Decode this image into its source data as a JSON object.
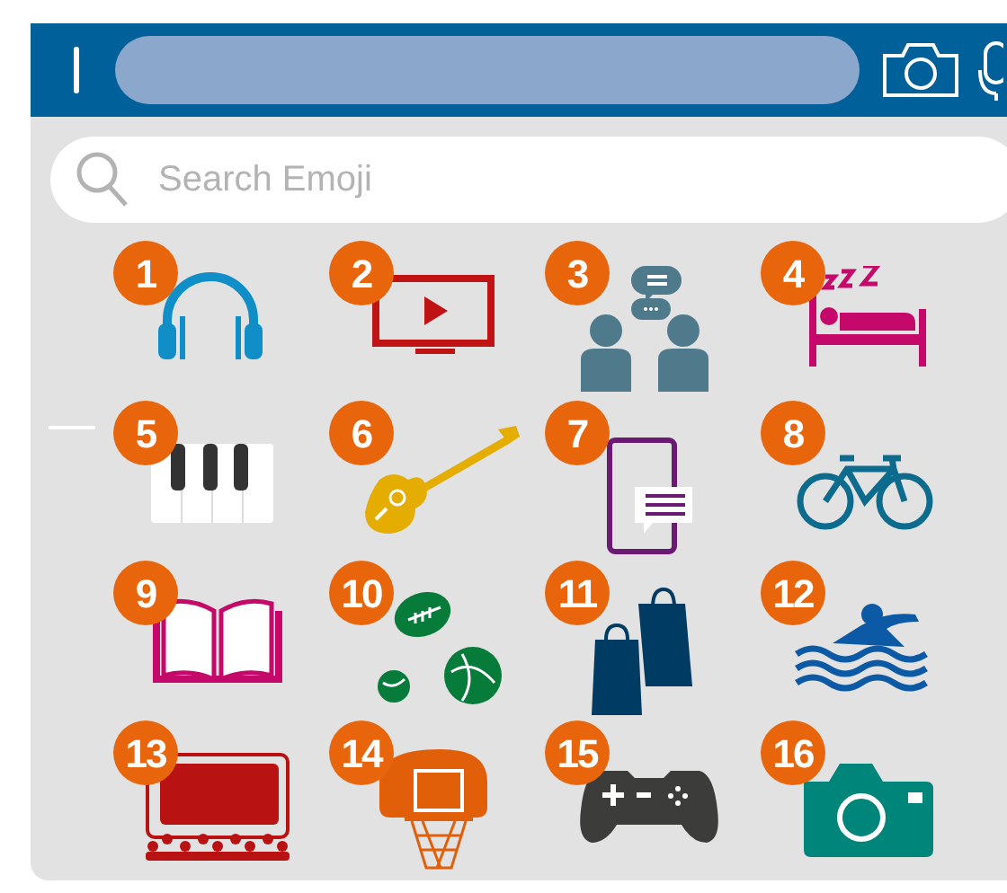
{
  "search": {
    "placeholder": "Search Emoji"
  },
  "items": [
    {
      "number": "1",
      "kind": "headphones"
    },
    {
      "number": "2",
      "kind": "tv"
    },
    {
      "number": "3",
      "kind": "chat"
    },
    {
      "number": "4",
      "kind": "sleep"
    },
    {
      "number": "5",
      "kind": "piano"
    },
    {
      "number": "6",
      "kind": "guitar"
    },
    {
      "number": "7",
      "kind": "phone"
    },
    {
      "number": "8",
      "kind": "bike"
    },
    {
      "number": "9",
      "kind": "book"
    },
    {
      "number": "10",
      "kind": "balls"
    },
    {
      "number": "11",
      "kind": "bags"
    },
    {
      "number": "12",
      "kind": "swim"
    },
    {
      "number": "13",
      "kind": "cinema"
    },
    {
      "number": "14",
      "kind": "hoop"
    },
    {
      "number": "15",
      "kind": "gamepad"
    },
    {
      "number": "16",
      "kind": "camera"
    }
  ]
}
